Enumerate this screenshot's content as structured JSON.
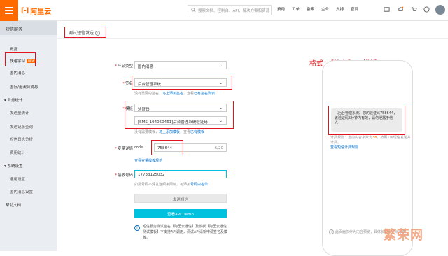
{
  "topbar": {
    "logo_text": "阿里云",
    "search_placeholder": "搜索文档、控制台、API、解决方案和资源",
    "nav": [
      "费用",
      "工单",
      "备案",
      "企业",
      "支持",
      "官网"
    ],
    "accent": "#ff6a00"
  },
  "sidebar": {
    "title": "短信服务",
    "items": [
      "概览",
      "快速学习",
      "国内消息",
      "国际/港澳台消息"
    ],
    "new_badge": "NEW",
    "group_stats": "业务统计",
    "stats_items": [
      "发送量统计",
      "发送记录查询",
      "短信日志分析",
      "费用统计"
    ],
    "group_settings": "系统设置",
    "settings_items": [
      "通用设置",
      "国内消息设置"
    ],
    "help": "帮助文档"
  },
  "page": {
    "title": "测试短信发送",
    "product_label": "产品类型",
    "product_value": "国内消息",
    "sign_label": "签名",
    "sign_value": "后台管理系统",
    "sign_hint_pre": "没有需要的签名，",
    "sign_hint_add": "马上添加签名",
    "sign_hint_mid": "，查看",
    "sign_hint_list": "已有签名列表",
    "template_label": "模板",
    "template_type": "验证码",
    "template_value": "[SMS_194050461]后台管理系统验证码",
    "template_hint_pre": "没有需要模板，",
    "template_hint_add": "马上添加模板",
    "template_hint_mid": "，查看",
    "template_hint_list": "已有模板",
    "var_label": "变量详情",
    "var_name": "code",
    "var_value": "758644",
    "var_count": "6/20",
    "var_hint": "查看变量模板规范",
    "phone_label": "接收号码",
    "phone_value": "17733125032",
    "phone_hint_pre": "如需号码不受发送频率限制，可添加",
    "phone_hint_link": "号码白名单",
    "send_button": "发送短信",
    "api_demo_button": "查看API Demo",
    "info_text": "短信服务测试签名【阿里云通信】及模板【阿里云通信测试模板】不支持API调用，调试API请新申请签名及模板。"
  },
  "preview": {
    "format_note": "格式：【签名】+ 模板",
    "message": "【后台管理系统】您的验证码758644，该验证码5分钟内有效，请勿泄露于他人！",
    "count_text_pre": "计费规则：当前内容字数为",
    "count_value": "38",
    "count_text_post": "，按照1条短信发送并计费。",
    "billing_link": "查看短信计费规则",
    "bottom_note": "此页面仅作为内容预览，具体长短以实际为准。",
    "watermark": "繁荣网"
  },
  "colors": {
    "highlight_box": "#e0141e",
    "button_blue": "#00c1de",
    "link": "#0070cc"
  }
}
